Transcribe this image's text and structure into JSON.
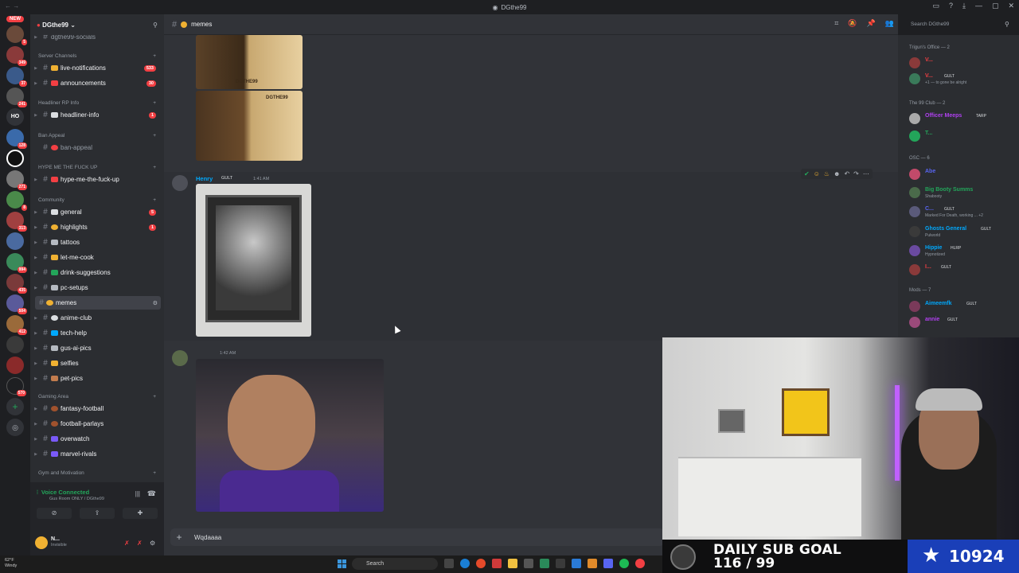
{
  "window": {
    "title": "DGthe99",
    "titlebar_left": "← →"
  },
  "rail": {
    "new_label": "NEW",
    "ho_label": "HO",
    "badges": [
      "5",
      "349",
      "37",
      "241",
      "128",
      "271",
      "8",
      "313",
      "994",
      "435",
      "504",
      "412",
      "570"
    ]
  },
  "guild": {
    "name": "DGthe99"
  },
  "categories": {
    "socials": "dgthe99-socials",
    "server_channels": "Server Channels",
    "headliner": "Headliner RP Info",
    "ban_appeal": "Ban Appeal",
    "hype": "HYPE ME THE FUCK UP",
    "community": "Community",
    "gaming": "Gaming Area",
    "gym": "Gym and Motivation"
  },
  "channels": {
    "live_notifications": {
      "label": "live-notifications",
      "count": "533"
    },
    "announcements": {
      "label": "announcements",
      "count": "30"
    },
    "headliner_info": {
      "label": "headliner-info",
      "count": "1"
    },
    "ban_appeal": {
      "label": "ban-appeal"
    },
    "hype": {
      "label": "hype-me-the-fuck-up"
    },
    "general": {
      "label": "general",
      "count": "5"
    },
    "highlights": {
      "label": "highlights",
      "count": "1"
    },
    "tattoos": {
      "label": "tattoos"
    },
    "let_me_cook": {
      "label": "let-me-cook"
    },
    "drink_suggestions": {
      "label": "drink-suggestions"
    },
    "pc_setups": {
      "label": "pc-setups"
    },
    "memes": {
      "label": "memes"
    },
    "anime_club": {
      "label": "anime-club"
    },
    "tech_help": {
      "label": "tech-help"
    },
    "gus_ai_pics": {
      "label": "gus-ai-pics"
    },
    "selfies": {
      "label": "selfies"
    },
    "pet_pics": {
      "label": "pet-pics"
    },
    "fantasy_football": {
      "label": "fantasy-football"
    },
    "football_parlays": {
      "label": "football-parlays"
    },
    "overwatch": {
      "label": "overwatch"
    },
    "marvel_rivals": {
      "label": "marvel-rivals"
    }
  },
  "voice": {
    "status": "Voice Connected",
    "room": "Gus Room ONLY / DGthe99"
  },
  "user": {
    "name": "N...",
    "status": "Invisible"
  },
  "chat": {
    "channel": "memes",
    "messages": [
      {
        "author": "Henry",
        "role": "GULT",
        "time": "1:41 AM"
      },
      {
        "author": "",
        "role": "",
        "time": "1:42 AM"
      }
    ],
    "card_title": "DGTHE99",
    "composer_value": "Wqdaaaa"
  },
  "search": {
    "placeholder": "Search DGthe99"
  },
  "members": {
    "groups": [
      {
        "title": "Trigun's Office — 2"
      },
      {
        "title": "The 99 Club — 2"
      },
      {
        "title": "OSC — 6"
      },
      {
        "title": "Mods — 7"
      }
    ],
    "list": [
      {
        "name": "V...",
        "color": "#f23f43",
        "tag": "",
        "status": ""
      },
      {
        "name": "V...",
        "color": "#f23f43",
        "tag": "GULT",
        "status": "+1 — to gone be alright"
      },
      {
        "name": "Officer Meeps",
        "color": "#b040f0",
        "tag": "TARP",
        "status": ""
      },
      {
        "name": "T...",
        "color": "#23a55a",
        "tag": "",
        "status": ""
      },
      {
        "name": "Abe",
        "color": "#5865f2",
        "tag": "",
        "status": ""
      },
      {
        "name": "Big Booty Summs",
        "color": "#23a55a",
        "tag": "",
        "status": "Shabooty"
      },
      {
        "name": "C...",
        "color": "#5865f2",
        "tag": "GULT",
        "status": "Marked For Death, working ... +2"
      },
      {
        "name": "Ghosts General",
        "color": "#00a8fc",
        "tag": "GULT",
        "status": "Pulworld"
      },
      {
        "name": "Hippie",
        "color": "#00a8fc",
        "tag": "HLRP",
        "status": "Hypnotized"
      },
      {
        "name": "I...",
        "color": "#f23f43",
        "tag": "GULT",
        "status": ""
      },
      {
        "name": "Aimeemfk",
        "color": "#00a8fc",
        "tag": "GULT",
        "status": ""
      },
      {
        "name": "annie",
        "color": "#b040f0",
        "tag": "GULT",
        "status": ""
      }
    ]
  },
  "overlay": {
    "goal_line1": "DAILY SUB GOAL",
    "goal_line2": "116 / 99",
    "count": "10924"
  },
  "taskbar": {
    "temp": "62°F",
    "cond": "Windy",
    "search": "Search"
  },
  "colors": {
    "accent": "#5865f2",
    "red": "#f23f43",
    "green": "#23a55a"
  }
}
